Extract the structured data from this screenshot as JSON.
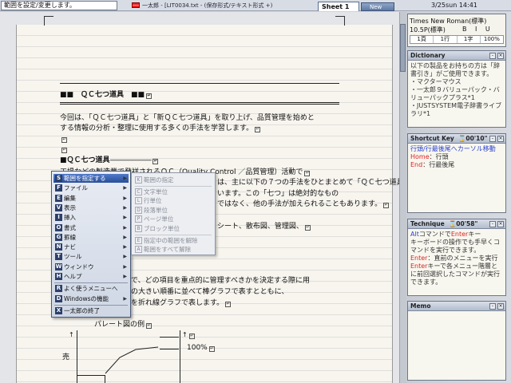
{
  "topbar": {
    "status_message": "範囲を設定/変更します。",
    "title": "一太郎 - [LIT0034.txt - (保存形式/テキスト形式 +)",
    "tab_sheet": "Sheet 1",
    "tab_new": "New",
    "datetime": "3/25sun  14:41"
  },
  "document": {
    "heading1": "■■　ＱＣ七つ道具　■■",
    "p1_line1": "今回は、「ＱＣ七つ道具」と「新ＱＣ七つ道具」を取り上げ、品質管理を始めと",
    "p1_line2": "する情報の分析・整理に使用する多くの手法を学習します。",
    "heading2": "■ＱＣ七つ道具",
    "p2_line1": "工場などの製造業で発祥されるＱＣ（Quality Control ／品質管理）活動で",
    "p2_line2": "は、主に以下の７つの手法をひとまとめて「ＱＣ七つ道具」と言",
    "p2_line3": "います。この「七つ」は絶対的なもの",
    "p2_line4": "ではなく、他の手法が加えられることもあります。",
    "p2_line5": "シート、散布図、管理図、",
    "p3_line1": "で、どの項目を重点的に管理すべきかを決定する際に用",
    "p3_line2": "の大きい順番に並べて棒グラフで表すとともに、",
    "p3_line3": "を折れ線グラフで表します。",
    "chart_title": "パレート図の例",
    "chart_percent": "100%",
    "chart_ylabel": "売"
  },
  "menu": {
    "items": [
      {
        "key": "S",
        "label": "範囲を指定する",
        "arrow": "▶",
        "selected": true
      },
      {
        "key": "F",
        "label": "ファイル",
        "arrow": "▶"
      },
      {
        "key": "E",
        "label": "編集",
        "arrow": "▶"
      },
      {
        "key": "V",
        "label": "表示",
        "arrow": "▶"
      },
      {
        "key": "I",
        "label": "挿入",
        "arrow": "▶"
      },
      {
        "key": "O",
        "label": "書式",
        "arrow": "▶"
      },
      {
        "key": "G",
        "label": "罫線",
        "arrow": "▶"
      },
      {
        "key": "N",
        "label": "ナビ",
        "arrow": "▶"
      },
      {
        "key": "T",
        "label": "ツール",
        "arrow": "▶"
      },
      {
        "key": "W",
        "label": "ウィンドウ",
        "arrow": "▶"
      },
      {
        "key": "H",
        "label": "ヘルプ",
        "arrow": "▶"
      },
      {
        "key": "R",
        "label": "よく使うメニューへ",
        "arrow": ""
      },
      {
        "key": "D",
        "label": "Windowsの機能",
        "arrow": "▶"
      },
      {
        "key": "X",
        "label": "一太郎の終了",
        "arrow": ""
      }
    ]
  },
  "submenu": {
    "items": [
      {
        "key": "K",
        "label": "範囲の指定"
      },
      {
        "key": "C",
        "label": "文字単位"
      },
      {
        "key": "L",
        "label": "行単位"
      },
      {
        "key": "D",
        "label": "段落単位"
      },
      {
        "key": "P",
        "label": "ページ単位"
      },
      {
        "key": "B",
        "label": "ブロック単位"
      },
      {
        "key": "E",
        "label": "指定中の範囲を解除"
      },
      {
        "key": "A",
        "label": "範囲をすべて解除"
      }
    ]
  },
  "sidebar": {
    "font_name": "Times New Roman(標準)",
    "font_size": "10.5P(標準)",
    "font_style": "B I U",
    "pos_page": "1頁",
    "pos_line": "1行",
    "pos_col": "1字",
    "zoom": "100%",
    "dictionary": {
      "title": "Dictionary",
      "text": "以下の製品をお持ちの方は「辞書引き」がご使用できます。\n・マクターマウス\n・一太郎９バリューパック・バリューパックプラス*1\n・JUSTSYSTEM電子辞書ライブラリ*1"
    },
    "shortcut": {
      "title": "Shortcut Key",
      "time": "00'10\"",
      "line1": "行頭/行最後尾へカーソル移動",
      "home_key": "Home",
      "home_desc": "：行頭",
      "end_key": "End",
      "end_desc": "：行最後尾"
    },
    "technique": {
      "title": "Technique",
      "time": "00'58\"",
      "l1a": "Alt",
      "l1b": "コマンドで",
      "l1c": "Enter",
      "l1d": "キー",
      "l2": "キーボードの操作でも手早くコマンドを実行できます。",
      "l3a": "Enter",
      "l3b": "：直前のメニューを実行",
      "l4a": "Enter",
      "l4b": "キーで各メニュー階層とに前回選択したコマンドが実行できます。"
    },
    "memo": {
      "title": "Memo"
    }
  },
  "colors": {
    "menu_highlight": "#2a4f9a",
    "link_blue": "#2a3fd0",
    "key_red": "#d22222"
  }
}
